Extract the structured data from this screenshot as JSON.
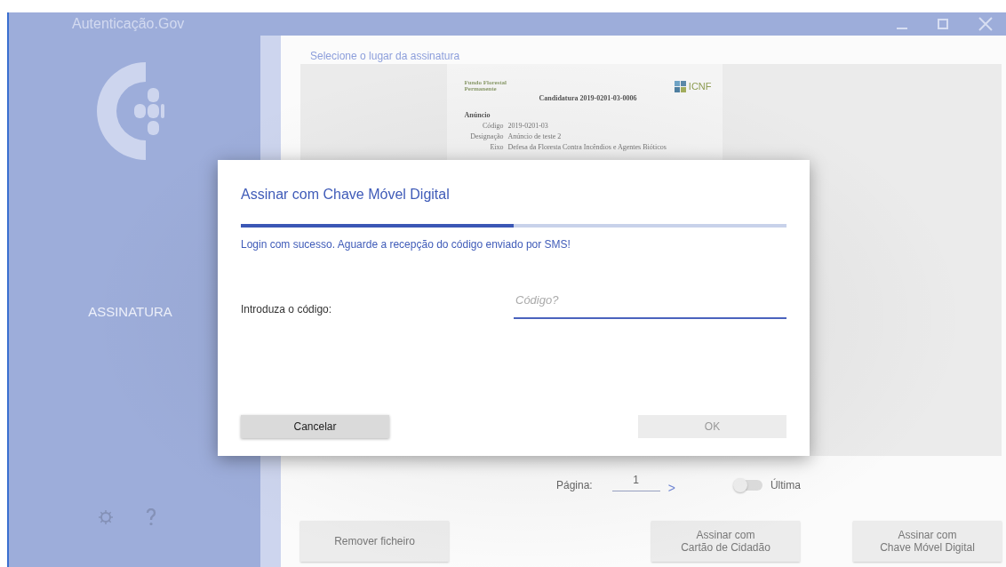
{
  "window": {
    "title": "Autenticação.Gov"
  },
  "sidebar": {
    "section": "ASSINATURA"
  },
  "main": {
    "heading": "Selecione o lugar da assinatura",
    "document": {
      "org": "Fundo Florestal Permanente",
      "logo_text": "ICNF",
      "title": "Candidatura 2019-0201-03-0006",
      "section": "Anúncio",
      "fields": [
        {
          "label": "Código",
          "value": "2019-0201-03"
        },
        {
          "label": "Designação",
          "value": "Anúncio de teste 2"
        },
        {
          "label": "Eixo",
          "value": "Defesa da Floresta Contra Incêndios e Agentes Bióticos"
        }
      ]
    },
    "pagination": {
      "label": "Página:",
      "value": "1",
      "next": ">",
      "last_toggle": {
        "label": "Última",
        "on": false
      }
    },
    "buttons": [
      {
        "lines": [
          "Remover ficheiro"
        ]
      },
      {
        "lines": [
          "Assinar com",
          "Cartão de Cidadão"
        ]
      },
      {
        "lines": [
          "Assinar com",
          "Chave Móvel Digital"
        ]
      }
    ]
  },
  "dialog": {
    "title": "Assinar com Chave Móvel Digital",
    "progress": {
      "level": 0.5
    },
    "message": "Login com sucesso. Aguarde a recepção do código enviado por SMS!",
    "field": {
      "label": "Introduza o código:",
      "placeholder": "Código?"
    },
    "buttons": [
      {
        "label": "Cancelar",
        "disabled": false
      },
      {
        "label": "OK",
        "disabled": true
      }
    ]
  }
}
